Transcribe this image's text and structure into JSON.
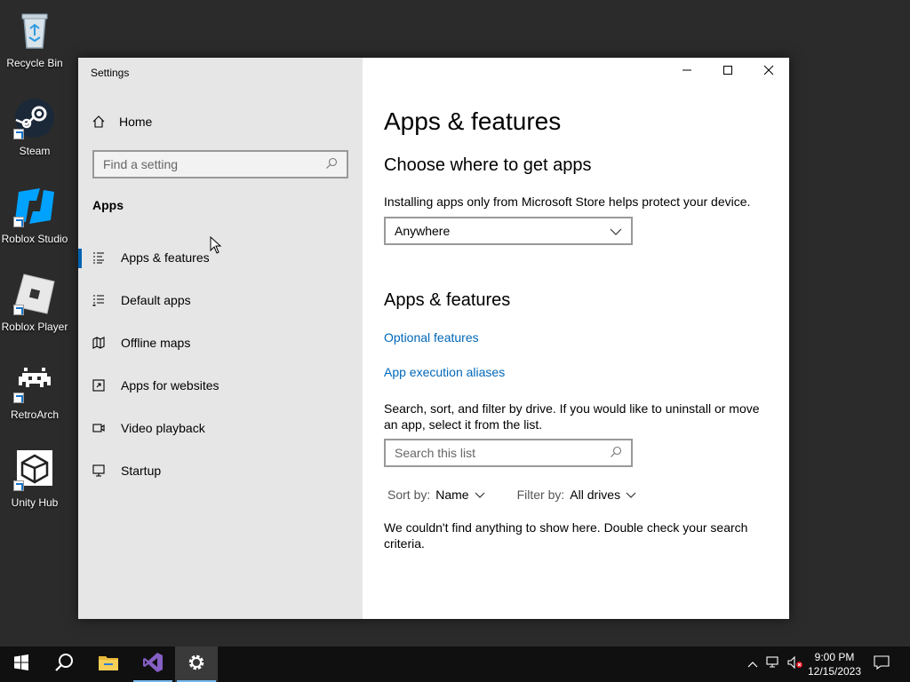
{
  "desktop": {
    "icons": [
      {
        "label": "Recycle Bin",
        "icon": "recycle-bin-icon"
      },
      {
        "label": "Steam",
        "icon": "steam-icon"
      },
      {
        "label": "Roblox Studio",
        "icon": "roblox-studio-icon"
      },
      {
        "label": "Roblox Player",
        "icon": "roblox-player-icon"
      },
      {
        "label": "RetroArch",
        "icon": "retroarch-icon"
      },
      {
        "label": "Unity Hub",
        "icon": "unity-hub-icon"
      }
    ]
  },
  "window": {
    "title": "Settings",
    "controls": {
      "minimize": "minimize-icon",
      "maximize": "maximize-icon",
      "close": "close-icon"
    }
  },
  "sidebar": {
    "home": "Home",
    "search_placeholder": "Find a setting",
    "section": "Apps",
    "items": [
      {
        "label": "Apps & features",
        "icon": "apps-features-icon",
        "active": true
      },
      {
        "label": "Default apps",
        "icon": "default-apps-icon"
      },
      {
        "label": "Offline maps",
        "icon": "offline-maps-icon"
      },
      {
        "label": "Apps for websites",
        "icon": "apps-websites-icon"
      },
      {
        "label": "Video playback",
        "icon": "video-playback-icon"
      },
      {
        "label": "Startup",
        "icon": "startup-icon"
      }
    ]
  },
  "main": {
    "title": "Apps & features",
    "choose_heading": "Choose where to get apps",
    "choose_desc": "Installing apps only from Microsoft Store helps protect your device.",
    "source_value": "Anywhere",
    "apps_heading": "Apps & features",
    "link_optional": "Optional features",
    "link_aliases": "App execution aliases",
    "search_desc": "Search, sort, and filter by drive. If you would like to uninstall or move an app, select it from the list.",
    "list_search_placeholder": "Search this list",
    "sort_label": "Sort by:",
    "sort_value": "Name",
    "filter_label": "Filter by:",
    "filter_value": "All drives",
    "empty_message": "We couldn't find anything to show here. Double check your search criteria."
  },
  "taskbar": {
    "buttons": [
      "start-icon",
      "search-icon",
      "file-explorer-icon",
      "visual-studio-icon",
      "settings-icon"
    ],
    "time": "9:00 PM",
    "date": "12/15/2023"
  },
  "colors": {
    "accent": "#0063b1",
    "link": "#0067b8",
    "sidebar_bg": "#e6e6e6",
    "desktop_bg": "#2b2b2b",
    "taskbar_bg": "#101010"
  }
}
